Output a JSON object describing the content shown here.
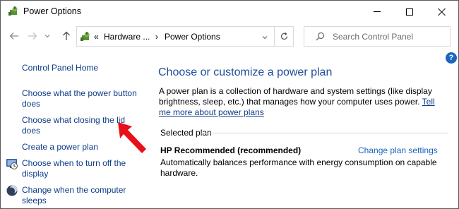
{
  "window": {
    "title": "Power Options"
  },
  "nav": {
    "breadcrumb_prefix": "«",
    "breadcrumb_parent": "Hardware ...",
    "breadcrumb_sep": "›",
    "breadcrumb_current": "Power Options",
    "search_placeholder": "Search Control Panel"
  },
  "help_label": "?",
  "sidebar": {
    "home": "Control Panel Home",
    "items": [
      {
        "line1": "Choose what the power button",
        "line2": "does"
      },
      {
        "line1": "Choose what closing the lid",
        "line2": "does"
      },
      {
        "line1": "Create a power plan"
      },
      {
        "line1": "Choose when to turn off the",
        "line2": "display"
      },
      {
        "line1": "Change when the computer",
        "line2": "sleeps"
      }
    ]
  },
  "main": {
    "title": "Choose or customize a power plan",
    "description": "A power plan is a collection of hardware and system settings (like display brightness, sleep, etc.) that manages how your computer uses power.",
    "tell_me_link": "Tell me more about power plans",
    "selected_plan_label": "Selected plan",
    "plan_name": "HP Recommended (recommended)",
    "change_settings_link": "Change plan settings",
    "plan_description": "Automatically balances performance with energy consumption on capable hardware."
  },
  "colors": {
    "link": "#0d3c87",
    "title": "#1d4c99",
    "accent": "#1a65c0",
    "arrow": "#e8101a"
  },
  "icons": [
    "power-options-icon",
    "minimize-icon",
    "maximize-icon",
    "close-icon",
    "back-arrow-icon",
    "forward-arrow-icon",
    "recent-chevron-icon",
    "up-arrow-icon",
    "refresh-icon",
    "search-icon",
    "help-icon",
    "display-timer-icon",
    "sleep-moon-icon",
    "red-arrow-annotation"
  ]
}
